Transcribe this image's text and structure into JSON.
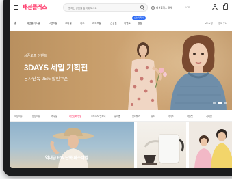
{
  "header": {
    "logo_text": "패션플러스",
    "search_placeholder": "원하는 상품을 검색해 보세요",
    "location_label": "패션플러스 전체",
    "language_label": "KOR"
  },
  "gnb": {
    "items": [
      "홈",
      "패션플러스몰",
      "브랜드몰",
      "코디몰",
      "키즈",
      "라이프몰",
      "신상품",
      "이벤트",
      "랭킹"
    ],
    "badge": "오늘의 특가",
    "right_items": [
      "MY쇼핑",
      "장바구니"
    ]
  },
  "hero": {
    "subtitle": "시즌오프 이벤트",
    "title": "3DAYS 세일 기획전",
    "description": "본사단독 25% 할인쿠폰"
  },
  "categories": {
    "items": [
      "여성의류",
      "남성의류",
      "캐주얼",
      "패션잡화/신발",
      "스포츠/아웃도어",
      "유아동",
      "언더웨어",
      "뷰티",
      "라이프",
      "아울렛",
      "기획전"
    ],
    "active_index": 3
  },
  "tiles": {
    "caption": "역대급 F/W 단독 페스티벌"
  },
  "colors": {
    "brand": "#ff2a5f",
    "badge": "#2f6cf5",
    "hero_bg": "#c79d6a"
  }
}
